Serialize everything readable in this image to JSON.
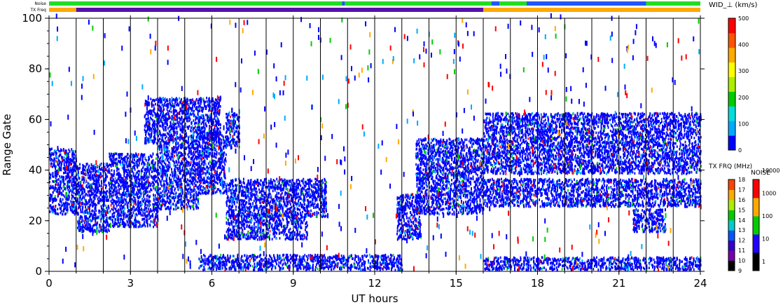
{
  "chart_data": {
    "type": "heatmap",
    "title": "",
    "xlabel": "UT hours",
    "ylabel": "Range Gate",
    "xlim": [
      0,
      24
    ],
    "ylim": [
      0,
      100
    ],
    "x_ticks": [
      0,
      3,
      6,
      9,
      12,
      15,
      18,
      21,
      24
    ],
    "y_ticks": [
      0,
      20,
      40,
      60,
      80,
      100
    ],
    "hour_gridlines": [
      1,
      2,
      3,
      4,
      5,
      6,
      7,
      8,
      9,
      10,
      11,
      12,
      13,
      14,
      15,
      16,
      17,
      18,
      19,
      20,
      21,
      22,
      23
    ],
    "grid": true,
    "status_bars": [
      {
        "label": "Noise",
        "segments": [
          {
            "start": 0,
            "end": 10.8,
            "color": "#22dd22"
          },
          {
            "start": 10.8,
            "end": 10.9,
            "color": "#2255ff"
          },
          {
            "start": 10.9,
            "end": 16.3,
            "color": "#22dd22"
          },
          {
            "start": 16.3,
            "end": 16.6,
            "color": "#2255ff"
          },
          {
            "start": 16.6,
            "end": 17.6,
            "color": "#22dd22"
          },
          {
            "start": 17.6,
            "end": 22.0,
            "color": "#2255ff"
          },
          {
            "start": 22.0,
            "end": 24,
            "color": "#22dd22"
          }
        ]
      },
      {
        "label": "TX Freq",
        "segments": [
          {
            "start": 0,
            "end": 1.0,
            "color": "#ffaa00"
          },
          {
            "start": 1.0,
            "end": 16.0,
            "color": "#5511aa"
          },
          {
            "start": 16.0,
            "end": 24,
            "color": "#ffaa00"
          }
        ]
      }
    ],
    "scatter_regions": [
      {
        "x": [
          0,
          1.0
        ],
        "y": [
          22,
          48
        ],
        "value": 60
      },
      {
        "x": [
          1.0,
          2.2
        ],
        "y": [
          15,
          42
        ],
        "value": 50
      },
      {
        "x": [
          2.2,
          4.0
        ],
        "y": [
          17,
          46
        ],
        "value": 50
      },
      {
        "x": [
          4.0,
          5.5
        ],
        "y": [
          24,
          50
        ],
        "value": 50
      },
      {
        "x": [
          5.5,
          6.5
        ],
        "y": [
          30,
          55
        ],
        "value": 55
      },
      {
        "x": [
          6.5,
          7.0
        ],
        "y": [
          48,
          62
        ],
        "value": 60
      },
      {
        "x": [
          3.5,
          6.3
        ],
        "y": [
          50,
          68
        ],
        "value": 80
      },
      {
        "x": [
          6.5,
          10.2
        ],
        "y": [
          21,
          36
        ],
        "value": 50
      },
      {
        "x": [
          6.5,
          9.5
        ],
        "y": [
          12,
          22
        ],
        "value": 50
      },
      {
        "x": [
          5.5,
          13.0
        ],
        "y": [
          0,
          6
        ],
        "value": 40
      },
      {
        "x": [
          12.8,
          13.7
        ],
        "y": [
          12,
          30
        ],
        "value": 50
      },
      {
        "x": [
          13.5,
          16.0
        ],
        "y": [
          22,
          52
        ],
        "value": 50
      },
      {
        "x": [
          16.0,
          24.0
        ],
        "y": [
          38,
          62
        ],
        "value": 50
      },
      {
        "x": [
          16.0,
          24.0
        ],
        "y": [
          25,
          36
        ],
        "value": 50
      },
      {
        "x": [
          21.5,
          22.7
        ],
        "y": [
          15,
          24
        ],
        "value": 50
      },
      {
        "x": [
          16.0,
          24.0
        ],
        "y": [
          0,
          5
        ],
        "value": 40
      }
    ],
    "colorbars": [
      {
        "title": "WID_⊥ (km/s)",
        "ticks": [
          0,
          100,
          200,
          300,
          400,
          500
        ]
      },
      {
        "title": "TX FRQ (MHz)",
        "ticks": [
          9,
          10,
          11,
          12,
          13,
          14,
          15,
          16,
          17,
          18
        ]
      },
      {
        "title": "NOISE",
        "ticks": [
          1,
          10,
          100,
          1000,
          10000
        ]
      }
    ],
    "colors": {
      "width_scale": [
        "#0000ff",
        "#00aaff",
        "#00dddd",
        "#00cc00",
        "#aaee00",
        "#ffff00",
        "#ffaa00",
        "#ff5500",
        "#ff0000"
      ],
      "txfreq_scale": [
        "#000000",
        "#7700aa",
        "#3300cc",
        "#0055ff",
        "#00cccc",
        "#00cc00",
        "#aaee00",
        "#ffaa00",
        "#ff4400",
        "#ff0000"
      ],
      "noise_scale": [
        "#000000",
        "#2200ff",
        "#00cc00",
        "#ffaa00",
        "#ff0000"
      ]
    }
  }
}
